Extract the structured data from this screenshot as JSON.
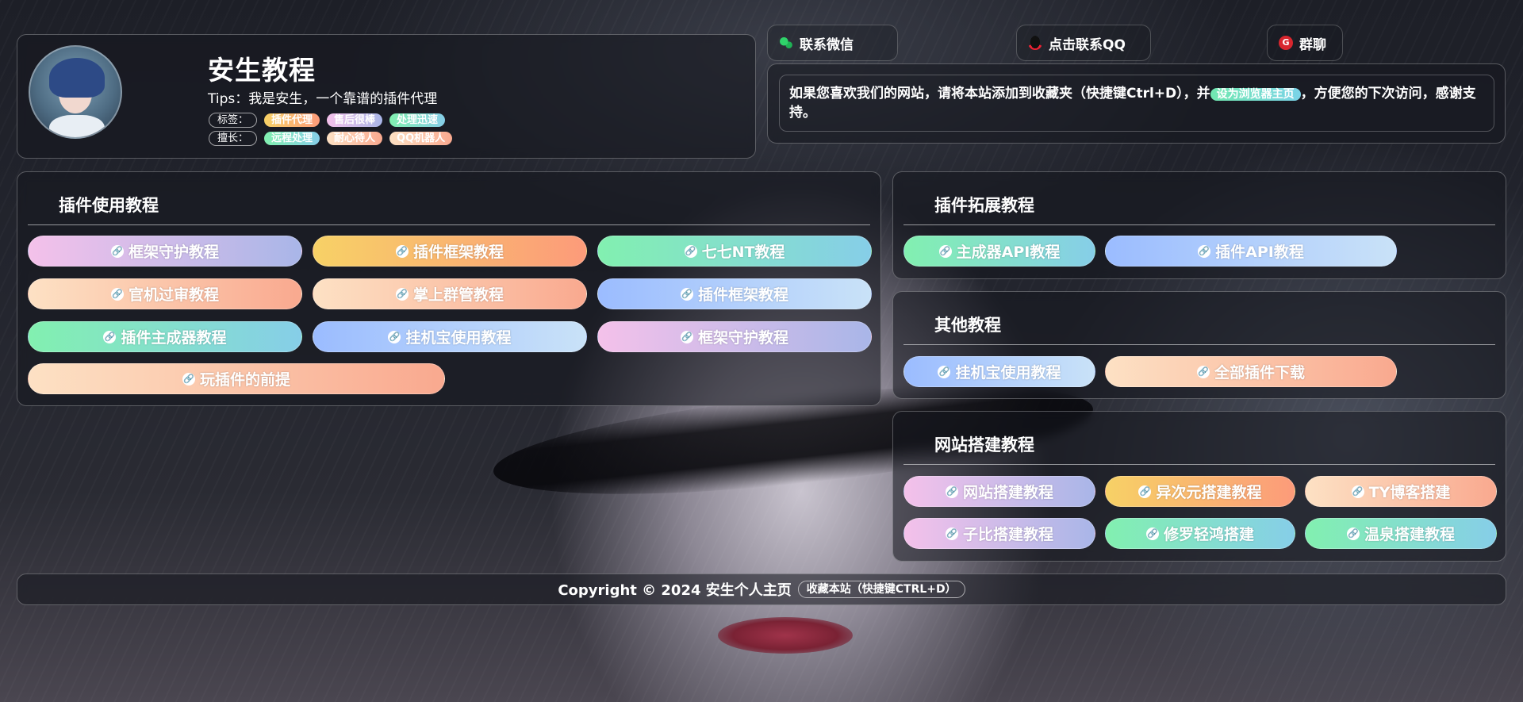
{
  "profile": {
    "title": "安生教程",
    "tips": "Tips：我是安生，一个靠谱的插件代理",
    "tag_label": "标签：",
    "tags": [
      "插件代理",
      "售后很棒",
      "处理迅速"
    ],
    "skill_label": "擅长：",
    "skills": [
      "远程处理",
      "耐心待人",
      "QQ机器人"
    ]
  },
  "contacts": {
    "wechat": "联系微信",
    "qq": "点击联系QQ",
    "group": "群聊",
    "group_icon_text": "G"
  },
  "notice": {
    "text_before": "如果您喜欢我们的网站，请将本站添加到收藏夹（快捷键Ctrl+D），并",
    "highlight": "设为浏览器主页",
    "text_after": "，方便您的下次访问，感谢支持。"
  },
  "sections": {
    "plugin_usage": {
      "title": "插件使用教程",
      "links": [
        "框架守护教程",
        "插件框架教程",
        "七七NT教程",
        "官机过审教程",
        "掌上群管教程",
        "插件框架教程",
        "插件主成器教程",
        "挂机宝使用教程",
        "框架守护教程",
        "玩插件的前提"
      ]
    },
    "plugin_ext": {
      "title": "插件拓展教程",
      "links": [
        "主成器API教程",
        "插件API教程"
      ]
    },
    "other": {
      "title": "其他教程",
      "links": [
        "挂机宝使用教程",
        "全部插件下载"
      ]
    },
    "site_build": {
      "title": "网站搭建教程",
      "links": [
        "网站搭建教程",
        "异次元搭建教程",
        "TY博客搭建",
        "子比搭建教程",
        "修罗轻鸿搭建",
        "温泉搭建教程"
      ]
    }
  },
  "link_icon": "🔗",
  "footer": {
    "copyright": "Copyright © 2024 安生个人主页",
    "favorite": "收藏本站（快捷键CTRL+D）"
  },
  "colors": {
    "pink": "#f4c1ea",
    "orange": "#f7d166",
    "teal": "#82f0b0",
    "peach": "#fde1c4",
    "blue": "#9bbcff"
  }
}
